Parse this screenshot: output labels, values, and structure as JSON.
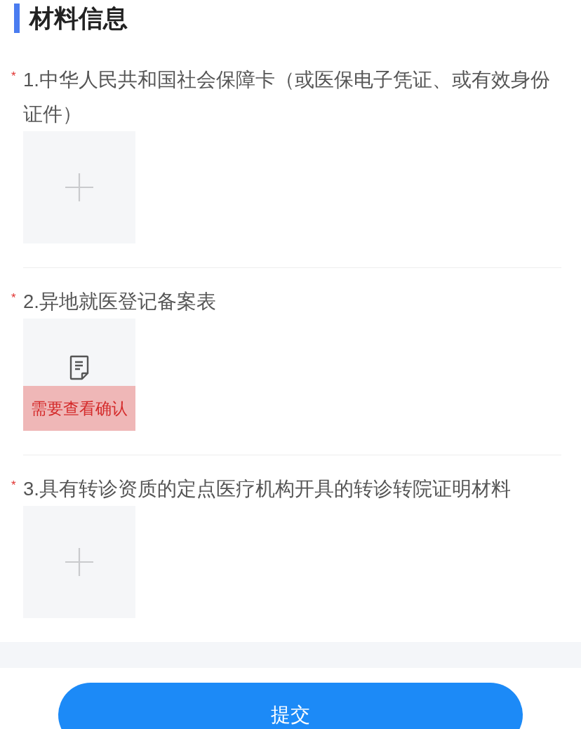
{
  "section": {
    "title": "材料信息"
  },
  "materials": [
    {
      "marker": "*",
      "label": "1.中华人民共和国社会保障卡（或医保电子凭证、或有效身份证件）",
      "upload": {
        "kind": "empty"
      }
    },
    {
      "marker": "*",
      "label": "2.异地就医登记备案表",
      "upload": {
        "kind": "file",
        "notice": "需要查看确认"
      }
    },
    {
      "marker": "*",
      "label": "3.具有转诊资质的定点医疗机构开具的转诊转院证明材料",
      "upload": {
        "kind": "empty"
      }
    }
  ],
  "submit_button": "提交"
}
